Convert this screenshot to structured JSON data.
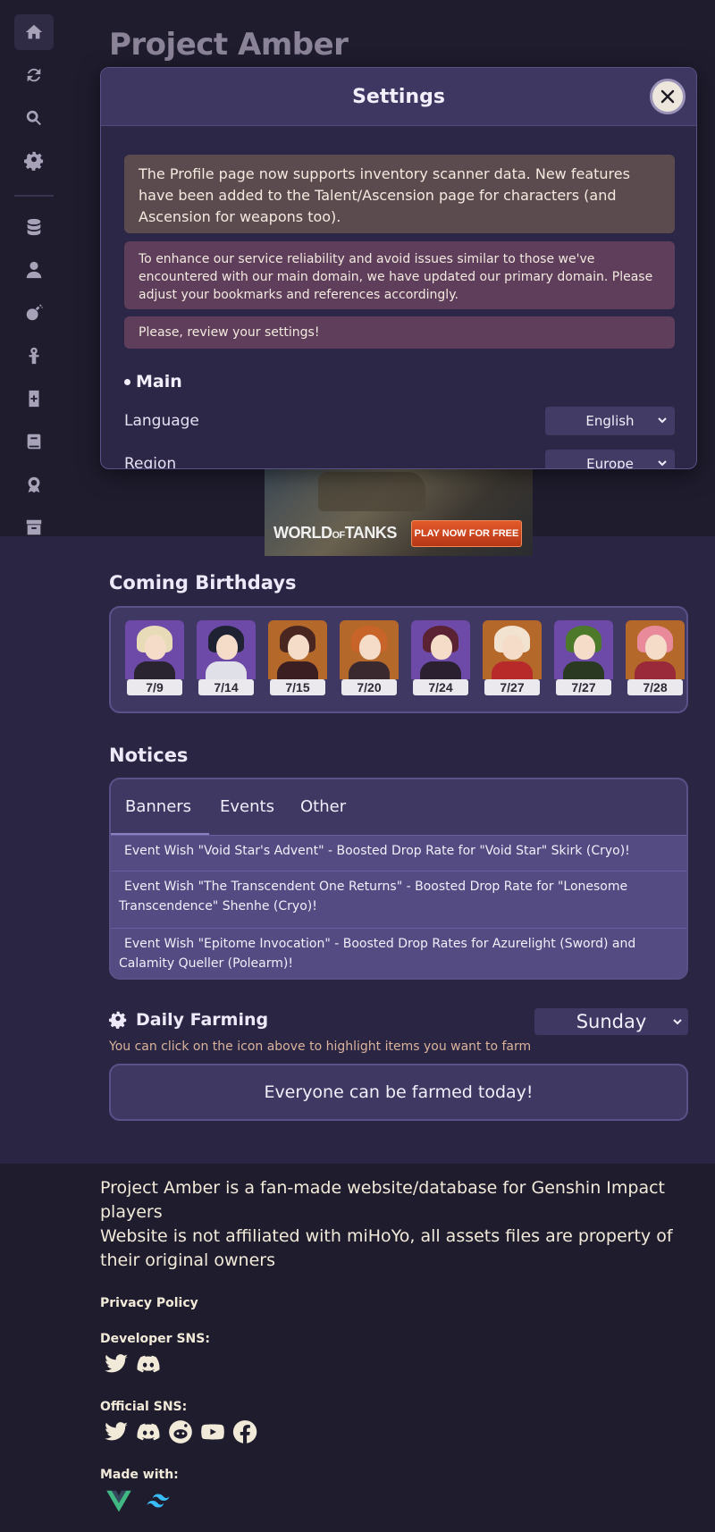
{
  "app": {
    "title": "Project Amber"
  },
  "sidebar": {
    "items": [
      {
        "name": "home-icon"
      },
      {
        "name": "refresh-icon"
      },
      {
        "name": "search-icon"
      },
      {
        "name": "gear-icon"
      },
      {
        "name": "database-icon"
      },
      {
        "name": "user-icon"
      },
      {
        "name": "bomb-icon"
      },
      {
        "name": "ankh-icon"
      },
      {
        "name": "card-icon"
      },
      {
        "name": "book-icon"
      },
      {
        "name": "badge-icon"
      },
      {
        "name": "archive-icon"
      }
    ]
  },
  "modal": {
    "title": "Settings",
    "alerts": [
      "The Profile page now supports inventory scanner data. New features have been added to the Talent/Ascension page for characters (and Ascension for weapons too).",
      "To enhance our service reliability and avoid issues similar to those we've encountered with our main domain, we have updated our primary domain. Please adjust your bookmarks and references accordingly.",
      "Please, review your settings!"
    ],
    "section": "Main",
    "settings": [
      {
        "label": "Language",
        "value": "English"
      },
      {
        "label": "Region",
        "value": "Europe"
      }
    ]
  },
  "ad": {
    "brand": "WORLD",
    "brand_small": "OF",
    "brand_tail": "TANKS",
    "cta": "PLAY NOW FOR FREE"
  },
  "birthdays": {
    "title": "Coming Birthdays",
    "items": [
      {
        "date": "7/9",
        "bg": "#6e4aa8",
        "hair": "#e8dcb8",
        "body": "#2a2330"
      },
      {
        "date": "7/14",
        "bg": "#6e4aa8",
        "hair": "#1e2233",
        "body": "#e0e0e8"
      },
      {
        "date": "7/15",
        "bg": "#b4682a",
        "hair": "#4a2620",
        "body": "#3a1e22"
      },
      {
        "date": "7/20",
        "bg": "#b4682a",
        "hair": "#c8642a",
        "body": "#3a2a30"
      },
      {
        "date": "7/24",
        "bg": "#6e4aa8",
        "hair": "#5a2233",
        "body": "#2a2030"
      },
      {
        "date": "7/27",
        "bg": "#b4682a",
        "hair": "#f2e2d0",
        "body": "#b82a2a"
      },
      {
        "date": "7/27",
        "bg": "#6e4aa8",
        "hair": "#4c7a2a",
        "body": "#2a3a22"
      },
      {
        "date": "7/28",
        "bg": "#b4682a",
        "hair": "#e88a9a",
        "body": "#9a2a3a"
      }
    ]
  },
  "notices": {
    "title": "Notices",
    "tabs": [
      "Banners",
      "Events",
      "Other"
    ],
    "rows": [
      "Event Wish \"Void Star's Advent\" - Boosted Drop Rate for \"Void Star\" Skirk (Cryo)!",
      "Event Wish \"The Transcendent One Returns\" - Boosted Drop Rate for \"Lonesome Transcendence\" Shenhe (Cryo)!",
      "Event Wish \"Epitome Invocation\" - Boosted Drop Rates for Azurelight (Sword) and Calamity Queller (Polearm)!"
    ]
  },
  "farming": {
    "title": "Daily Farming",
    "hint": "You can click on the icon above to highlight items you want to farm",
    "day": "Sunday",
    "message": "Everyone can be farmed today!"
  },
  "footer": {
    "line1": "Project Amber is a fan-made website/database for Genshin Impact players",
    "line2": "Website is not affiliated with miHoYo, all assets files are property of their original owners",
    "privacy": "Privacy Policy",
    "dev_sns": "Developer SNS:",
    "official_sns": "Official SNS:",
    "made_with": "Made with:"
  }
}
